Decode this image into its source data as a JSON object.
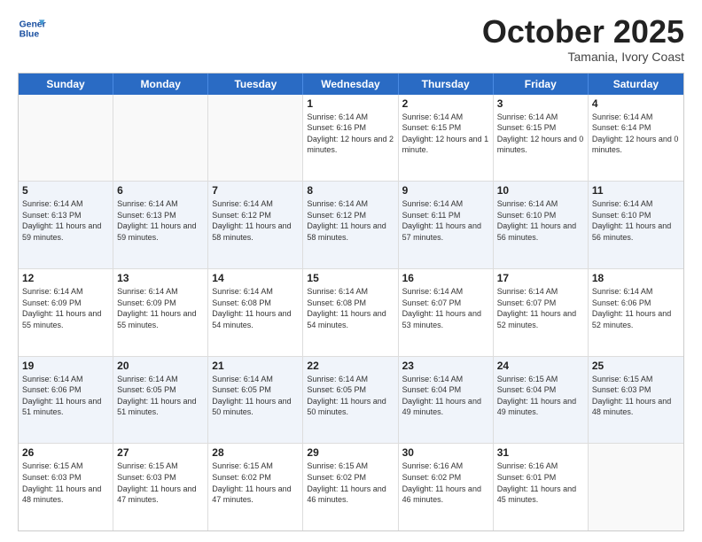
{
  "header": {
    "logo_line1": "General",
    "logo_line2": "Blue",
    "month": "October 2025",
    "location": "Tamania, Ivory Coast"
  },
  "days_of_week": [
    "Sunday",
    "Monday",
    "Tuesday",
    "Wednesday",
    "Thursday",
    "Friday",
    "Saturday"
  ],
  "weeks": [
    [
      {
        "day": "",
        "sunrise": "",
        "sunset": "",
        "daylight": "",
        "empty": true
      },
      {
        "day": "",
        "sunrise": "",
        "sunset": "",
        "daylight": "",
        "empty": true
      },
      {
        "day": "",
        "sunrise": "",
        "sunset": "",
        "daylight": "",
        "empty": true
      },
      {
        "day": "1",
        "sunrise": "Sunrise: 6:14 AM",
        "sunset": "Sunset: 6:16 PM",
        "daylight": "Daylight: 12 hours and 2 minutes."
      },
      {
        "day": "2",
        "sunrise": "Sunrise: 6:14 AM",
        "sunset": "Sunset: 6:15 PM",
        "daylight": "Daylight: 12 hours and 1 minute."
      },
      {
        "day": "3",
        "sunrise": "Sunrise: 6:14 AM",
        "sunset": "Sunset: 6:15 PM",
        "daylight": "Daylight: 12 hours and 0 minutes."
      },
      {
        "day": "4",
        "sunrise": "Sunrise: 6:14 AM",
        "sunset": "Sunset: 6:14 PM",
        "daylight": "Daylight: 12 hours and 0 minutes."
      }
    ],
    [
      {
        "day": "5",
        "sunrise": "Sunrise: 6:14 AM",
        "sunset": "Sunset: 6:13 PM",
        "daylight": "Daylight: 11 hours and 59 minutes."
      },
      {
        "day": "6",
        "sunrise": "Sunrise: 6:14 AM",
        "sunset": "Sunset: 6:13 PM",
        "daylight": "Daylight: 11 hours and 59 minutes."
      },
      {
        "day": "7",
        "sunrise": "Sunrise: 6:14 AM",
        "sunset": "Sunset: 6:12 PM",
        "daylight": "Daylight: 11 hours and 58 minutes."
      },
      {
        "day": "8",
        "sunrise": "Sunrise: 6:14 AM",
        "sunset": "Sunset: 6:12 PM",
        "daylight": "Daylight: 11 hours and 58 minutes."
      },
      {
        "day": "9",
        "sunrise": "Sunrise: 6:14 AM",
        "sunset": "Sunset: 6:11 PM",
        "daylight": "Daylight: 11 hours and 57 minutes."
      },
      {
        "day": "10",
        "sunrise": "Sunrise: 6:14 AM",
        "sunset": "Sunset: 6:10 PM",
        "daylight": "Daylight: 11 hours and 56 minutes."
      },
      {
        "day": "11",
        "sunrise": "Sunrise: 6:14 AM",
        "sunset": "Sunset: 6:10 PM",
        "daylight": "Daylight: 11 hours and 56 minutes."
      }
    ],
    [
      {
        "day": "12",
        "sunrise": "Sunrise: 6:14 AM",
        "sunset": "Sunset: 6:09 PM",
        "daylight": "Daylight: 11 hours and 55 minutes."
      },
      {
        "day": "13",
        "sunrise": "Sunrise: 6:14 AM",
        "sunset": "Sunset: 6:09 PM",
        "daylight": "Daylight: 11 hours and 55 minutes."
      },
      {
        "day": "14",
        "sunrise": "Sunrise: 6:14 AM",
        "sunset": "Sunset: 6:08 PM",
        "daylight": "Daylight: 11 hours and 54 minutes."
      },
      {
        "day": "15",
        "sunrise": "Sunrise: 6:14 AM",
        "sunset": "Sunset: 6:08 PM",
        "daylight": "Daylight: 11 hours and 54 minutes."
      },
      {
        "day": "16",
        "sunrise": "Sunrise: 6:14 AM",
        "sunset": "Sunset: 6:07 PM",
        "daylight": "Daylight: 11 hours and 53 minutes."
      },
      {
        "day": "17",
        "sunrise": "Sunrise: 6:14 AM",
        "sunset": "Sunset: 6:07 PM",
        "daylight": "Daylight: 11 hours and 52 minutes."
      },
      {
        "day": "18",
        "sunrise": "Sunrise: 6:14 AM",
        "sunset": "Sunset: 6:06 PM",
        "daylight": "Daylight: 11 hours and 52 minutes."
      }
    ],
    [
      {
        "day": "19",
        "sunrise": "Sunrise: 6:14 AM",
        "sunset": "Sunset: 6:06 PM",
        "daylight": "Daylight: 11 hours and 51 minutes."
      },
      {
        "day": "20",
        "sunrise": "Sunrise: 6:14 AM",
        "sunset": "Sunset: 6:05 PM",
        "daylight": "Daylight: 11 hours and 51 minutes."
      },
      {
        "day": "21",
        "sunrise": "Sunrise: 6:14 AM",
        "sunset": "Sunset: 6:05 PM",
        "daylight": "Daylight: 11 hours and 50 minutes."
      },
      {
        "day": "22",
        "sunrise": "Sunrise: 6:14 AM",
        "sunset": "Sunset: 6:05 PM",
        "daylight": "Daylight: 11 hours and 50 minutes."
      },
      {
        "day": "23",
        "sunrise": "Sunrise: 6:14 AM",
        "sunset": "Sunset: 6:04 PM",
        "daylight": "Daylight: 11 hours and 49 minutes."
      },
      {
        "day": "24",
        "sunrise": "Sunrise: 6:15 AM",
        "sunset": "Sunset: 6:04 PM",
        "daylight": "Daylight: 11 hours and 49 minutes."
      },
      {
        "day": "25",
        "sunrise": "Sunrise: 6:15 AM",
        "sunset": "Sunset: 6:03 PM",
        "daylight": "Daylight: 11 hours and 48 minutes."
      }
    ],
    [
      {
        "day": "26",
        "sunrise": "Sunrise: 6:15 AM",
        "sunset": "Sunset: 6:03 PM",
        "daylight": "Daylight: 11 hours and 48 minutes."
      },
      {
        "day": "27",
        "sunrise": "Sunrise: 6:15 AM",
        "sunset": "Sunset: 6:03 PM",
        "daylight": "Daylight: 11 hours and 47 minutes."
      },
      {
        "day": "28",
        "sunrise": "Sunrise: 6:15 AM",
        "sunset": "Sunset: 6:02 PM",
        "daylight": "Daylight: 11 hours and 47 minutes."
      },
      {
        "day": "29",
        "sunrise": "Sunrise: 6:15 AM",
        "sunset": "Sunset: 6:02 PM",
        "daylight": "Daylight: 11 hours and 46 minutes."
      },
      {
        "day": "30",
        "sunrise": "Sunrise: 6:16 AM",
        "sunset": "Sunset: 6:02 PM",
        "daylight": "Daylight: 11 hours and 46 minutes."
      },
      {
        "day": "31",
        "sunrise": "Sunrise: 6:16 AM",
        "sunset": "Sunset: 6:01 PM",
        "daylight": "Daylight: 11 hours and 45 minutes."
      },
      {
        "day": "",
        "sunrise": "",
        "sunset": "",
        "daylight": "",
        "empty": true
      }
    ]
  ]
}
